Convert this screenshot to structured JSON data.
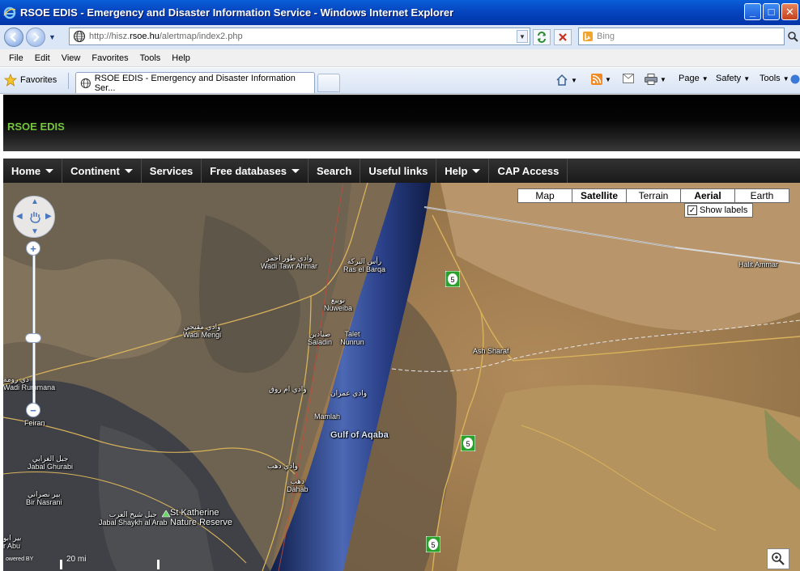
{
  "window": {
    "title": "RSOE EDIS - Emergency and Disaster Information Service - Windows Internet Explorer"
  },
  "address": {
    "url_prefix": "http://hisz.",
    "url_domain": "rsoe.hu",
    "url_path": "/alertmap/index2.php",
    "search_placeholder": "Bing"
  },
  "menu": [
    "File",
    "Edit",
    "View",
    "Favorites",
    "Tools",
    "Help"
  ],
  "favorites": {
    "label": "Favorites"
  },
  "tab": {
    "title": "RSOE EDIS - Emergency and Disaster Information Ser..."
  },
  "commands": {
    "page": "Page",
    "safety": "Safety",
    "tools": "Tools"
  },
  "site": {
    "name": "RSOE EDIS"
  },
  "nav": [
    "Home",
    "Continent",
    "Services",
    "Free databases",
    "Search",
    "Useful links",
    "Help",
    "CAP Access"
  ],
  "map": {
    "modes": [
      "Map",
      "Satellite",
      "Terrain",
      "Aerial",
      "Earth"
    ],
    "active_mode": "Satellite",
    "show_labels": "Show labels",
    "scale": "20 mi",
    "route_number": "5",
    "labels": {
      "wadi_tawr_ar": "وادي طور احمر",
      "wadi_tawr": "Wadi Tawr Ahmar",
      "ras_barqa_ar": "رأس البركة",
      "ras_barqa": "Ras el Barqa",
      "nuweiba_ar": "نويبع",
      "nuweiba": "Nuweiba",
      "wadi_mengi_ar": "وادي مقيجي",
      "wadi_mengi": "Wadi Mengi",
      "saiadin_ar": "صيادين",
      "saiadin": "Saiadin",
      "talet_nunrun": "Talet Nunrun",
      "ash_sharaf": "Ash Sharaf",
      "wadi_umm_ar": "وادي ام روق",
      "wadi_imran_ar": "وادي عمران",
      "wadi_rumma_ar": "دي رومة",
      "wadi_rumma": "Wadi Rummana",
      "feiran": "Feiran",
      "mamlah": "Mamlah",
      "gulf_aqaba": "Gulf of Aqaba",
      "jabal_ghurabi_ar": "جبل الغرابي",
      "jabal_ghurabi": "Jabal Ghurabi",
      "wadi_dahab_ar": "وادي دهب",
      "dahab_ar": "دهب",
      "dahab": "Dahab",
      "bir_nasrani_ar": "بير نصراني",
      "bir_nasrani": "Bir Nasrani",
      "jabal_shaykh_ar": "جبل شيخ العرب",
      "jabal_shaykh": "Jabal Shaykh al Arab",
      "st_katherine": "St Katherine Nature Reserve",
      "bir_abu_ar": "بير ابو",
      "bir_abu": "r Abu",
      "halit_ammar": "Halit Ammar",
      "powered_by": "owered BY"
    }
  },
  "colors": {
    "site_green": "#74c43c",
    "nav_bg": "#232323",
    "header_bg": "#000000"
  }
}
